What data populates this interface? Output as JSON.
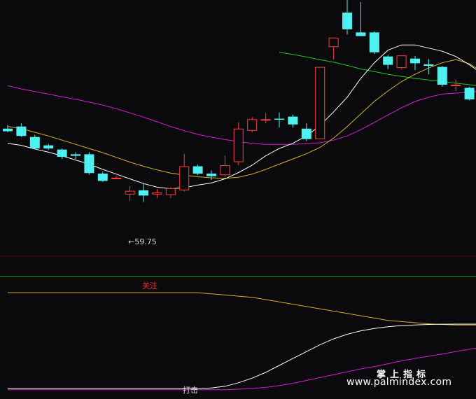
{
  "chart_data": {
    "type": "candlestick",
    "colors": {
      "up": "#ff3c3c",
      "down": "#4ff0f0",
      "ma_white": "#ffffff",
      "ma_yellow": "#d4b21e",
      "ma_magenta": "#d21ed2",
      "ma_green": "#1ec81e",
      "guanzhu_line": "#d4b21e",
      "daji_line_white": "#ffffff",
      "daji_line_magenta": "#d21ed2",
      "divider": "#5a0000",
      "guanzhu_level": "#1ea01e"
    },
    "y_range": [
      53.0,
      77.5
    ],
    "candles": [
      {
        "o": 65.2,
        "h": 65.55,
        "l": 64.85,
        "c": 64.95
      },
      {
        "o": 65.4,
        "h": 65.7,
        "l": 64.4,
        "c": 64.5
      },
      {
        "o": 64.4,
        "h": 64.6,
        "l": 63.2,
        "c": 63.3
      },
      {
        "o": 63.6,
        "h": 63.75,
        "l": 63.15,
        "c": 63.3
      },
      {
        "o": 63.2,
        "h": 63.3,
        "l": 62.3,
        "c": 62.5
      },
      {
        "o": 62.75,
        "h": 62.95,
        "l": 62.3,
        "c": 62.6
      },
      {
        "o": 62.75,
        "h": 62.95,
        "l": 60.8,
        "c": 60.95
      },
      {
        "o": 60.9,
        "h": 61.1,
        "l": 60.1,
        "c": 60.2
      },
      {
        "o": 60.5,
        "h": 60.7,
        "l": 60.4,
        "c": 60.5
      },
      {
        "o": 58.9,
        "h": 59.7,
        "l": 58.3,
        "c": 59.25
      },
      {
        "o": 59.3,
        "h": 60.0,
        "l": 58.2,
        "c": 58.8
      },
      {
        "o": 58.9,
        "h": 59.4,
        "l": 58.55,
        "c": 59.1
      },
      {
        "o": 58.85,
        "h": 59.6,
        "l": 58.55,
        "c": 59.5
      },
      {
        "o": 59.3,
        "h": 62.8,
        "l": 59.2,
        "c": 61.6
      },
      {
        "o": 61.6,
        "h": 61.75,
        "l": 60.75,
        "c": 60.9
      },
      {
        "o": 60.9,
        "h": 61.2,
        "l": 60.3,
        "c": 60.65
      },
      {
        "o": 60.75,
        "h": 62.6,
        "l": 60.6,
        "c": 61.7
      },
      {
        "o": 62.0,
        "h": 65.8,
        "l": 61.7,
        "c": 65.2
      },
      {
        "o": 65.0,
        "h": 66.3,
        "l": 64.85,
        "c": 66.1
      },
      {
        "o": 66.1,
        "h": 66.7,
        "l": 65.7,
        "c": 66.1
      },
      {
        "o": 66.15,
        "h": 66.75,
        "l": 65.3,
        "c": 66.05
      },
      {
        "o": 66.35,
        "h": 66.55,
        "l": 65.3,
        "c": 65.6
      },
      {
        "o": 65.2,
        "h": 65.7,
        "l": 64.0,
        "c": 64.2
      },
      {
        "o": 64.2,
        "h": 71.1,
        "l": 64.2,
        "c": 71.1
      },
      {
        "o": 73.0,
        "h": 73.9,
        "l": 71.8,
        "c": 73.9
      },
      {
        "o": 76.3,
        "h": 77.5,
        "l": 74.2,
        "c": 74.7
      },
      {
        "o": 74.4,
        "h": 77.3,
        "l": 74.05,
        "c": 74.05
      },
      {
        "o": 74.4,
        "h": 74.5,
        "l": 72.35,
        "c": 72.5
      },
      {
        "o": 72.1,
        "h": 72.25,
        "l": 70.9,
        "c": 71.3
      },
      {
        "o": 71.0,
        "h": 72.2,
        "l": 70.9,
        "c": 72.2
      },
      {
        "o": 71.9,
        "h": 72.15,
        "l": 70.8,
        "c": 71.45
      },
      {
        "o": 71.35,
        "h": 71.85,
        "l": 70.4,
        "c": 71.2
      },
      {
        "o": 71.1,
        "h": 71.2,
        "l": 69.2,
        "c": 69.4
      },
      {
        "o": 69.4,
        "h": 69.9,
        "l": 68.8,
        "c": 69.4
      },
      {
        "o": 69.1,
        "h": 69.2,
        "l": 67.9,
        "c": 68.0
      },
      {
        "o": 68.1,
        "h": 68.5,
        "l": 66.9,
        "c": 67.1
      }
    ],
    "ma_white": [
      63.8,
      63.6,
      63.25,
      62.95,
      62.6,
      62.2,
      61.8,
      61.3,
      60.85,
      60.4,
      59.95,
      59.6,
      59.45,
      59.55,
      59.8,
      60.0,
      60.4,
      61.0,
      61.7,
      62.6,
      63.3,
      63.8,
      64.5,
      65.5,
      66.8,
      68.2,
      70.0,
      71.5,
      72.7,
      73.2,
      73.2,
      72.9,
      72.6,
      72.1,
      71.3,
      70.4
    ],
    "ma_yellow": [
      65.4,
      65.2,
      64.85,
      64.5,
      64.1,
      63.7,
      63.3,
      62.9,
      62.45,
      62.0,
      61.6,
      61.25,
      60.95,
      60.75,
      60.6,
      60.5,
      60.45,
      60.55,
      60.85,
      61.3,
      61.8,
      62.3,
      62.8,
      63.4,
      64.3,
      65.4,
      66.6,
      67.8,
      68.8,
      69.7,
      70.4,
      71.0,
      71.5,
      71.8,
      71.4,
      70.6
    ],
    "ma_magenta": [
      69.3,
      69.0,
      68.75,
      68.5,
      68.25,
      68.0,
      67.75,
      67.45,
      67.1,
      66.7,
      66.3,
      65.85,
      65.4,
      65.0,
      64.65,
      64.4,
      64.15,
      63.95,
      63.8,
      63.7,
      63.7,
      63.7,
      63.75,
      63.85,
      64.1,
      64.5,
      65.1,
      65.8,
      66.5,
      67.2,
      67.8,
      68.2,
      68.5,
      68.6,
      68.7,
      68.8
    ],
    "ma_green_from": 20,
    "ma_green": [
      72.5,
      72.3,
      72.05,
      71.8,
      71.55,
      71.25,
      70.9,
      70.65,
      70.4,
      70.2,
      70.0,
      69.85,
      69.7,
      69.55,
      69.4,
      69.25
    ],
    "low_label": "←59.75",
    "indicator": {
      "guanzhu_label": "关注",
      "daji_label": "打击",
      "guanzhu_line": [
        0.86,
        0.86,
        0.86,
        0.86,
        0.86,
        0.86,
        0.86,
        0.86,
        0.86,
        0.86,
        0.86,
        0.86,
        0.86,
        0.86,
        0.86,
        0.85,
        0.84,
        0.83,
        0.82,
        0.8,
        0.78,
        0.76,
        0.74,
        0.72,
        0.7,
        0.68,
        0.66,
        0.64,
        0.62,
        0.61,
        0.6,
        0.59,
        0.585,
        0.58,
        0.58,
        0.58
      ],
      "white_line": [
        0.03,
        0.03,
        0.03,
        0.03,
        0.03,
        0.03,
        0.03,
        0.03,
        0.03,
        0.03,
        0.03,
        0.03,
        0.03,
        0.03,
        0.03,
        0.035,
        0.05,
        0.08,
        0.12,
        0.17,
        0.23,
        0.29,
        0.35,
        0.41,
        0.46,
        0.5,
        0.53,
        0.55,
        0.565,
        0.575,
        0.58,
        0.585,
        0.587,
        0.588,
        0.588,
        0.588
      ],
      "magenta_line": [
        0.02,
        0.02,
        0.02,
        0.02,
        0.02,
        0.02,
        0.02,
        0.02,
        0.02,
        0.02,
        0.02,
        0.02,
        0.02,
        0.02,
        0.02,
        0.02,
        0.02,
        0.025,
        0.03,
        0.04,
        0.055,
        0.075,
        0.1,
        0.125,
        0.15,
        0.175,
        0.2,
        0.22,
        0.245,
        0.27,
        0.29,
        0.31,
        0.33,
        0.35,
        0.37,
        0.39
      ]
    }
  },
  "watermark": {
    "chinese": "掌上指标",
    "url": "www.palmindex.com"
  }
}
